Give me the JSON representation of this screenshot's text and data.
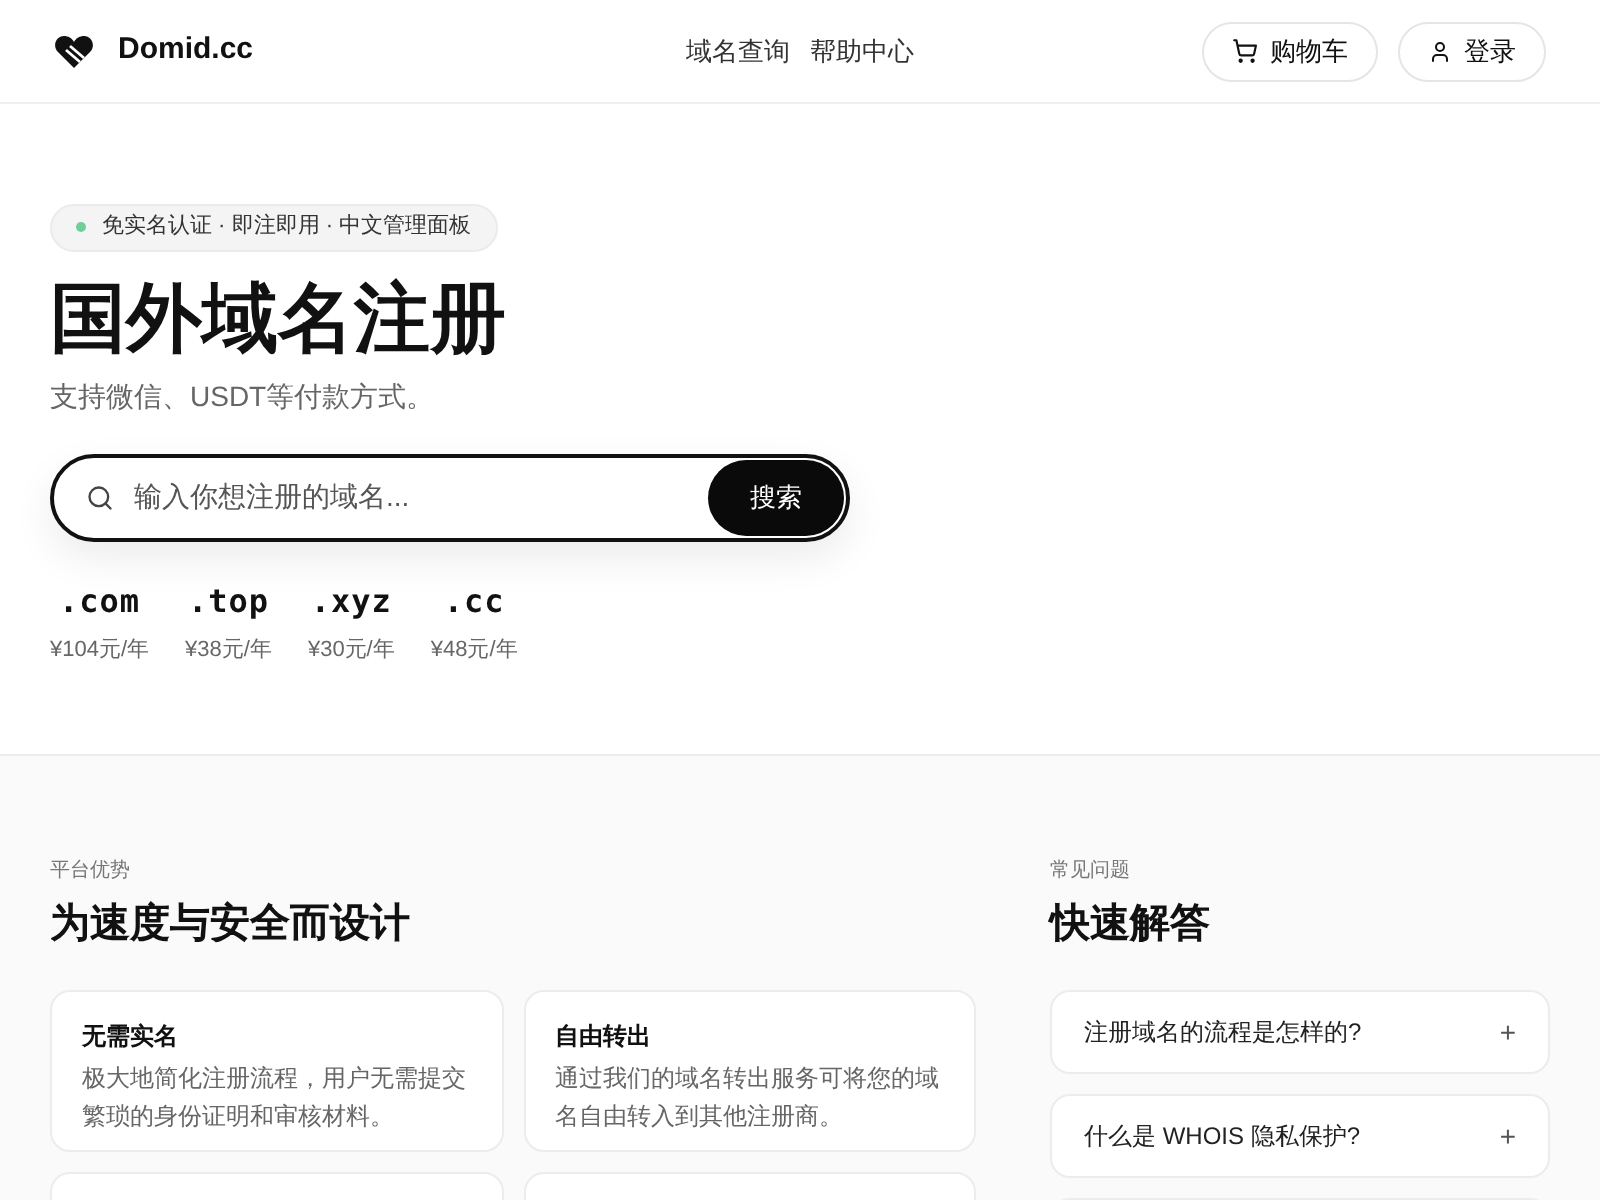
{
  "header": {
    "brand": "Domid.cc",
    "nav": [
      "域名查询",
      "帮助中心"
    ],
    "cart": "购物车",
    "login": "登录"
  },
  "hero": {
    "badge": "免实名认证 · 即注即用 · 中文管理面板",
    "title": "国外域名注册",
    "subtitle": "支持微信、USDT等付款方式。",
    "search": {
      "placeholder": "输入你想注册的域名...",
      "button": "搜索"
    },
    "tlds": [
      {
        "name": ".com",
        "price": "¥104元/年"
      },
      {
        "name": ".top",
        "price": "¥38元/年"
      },
      {
        "name": ".xyz",
        "price": "¥30元/年"
      },
      {
        "name": ".cc",
        "price": "¥48元/年"
      }
    ]
  },
  "features": {
    "eyebrow": "平台优势",
    "title": "为速度与安全而设计",
    "cards": [
      {
        "title": "无需实名",
        "text": "极大地简化注册流程，用户无需提交繁琐的身份证明和审核材料。"
      },
      {
        "title": "自由转出",
        "text": "通过我们的域名转出服务可将您的域名自由转入到其他注册商。"
      }
    ]
  },
  "faq": {
    "eyebrow": "常见问题",
    "title": "快速解答",
    "items": [
      {
        "question": "注册域名的流程是怎样的?",
        "toggle": "+"
      },
      {
        "question": "什么是 WHOIS 隐私保护?",
        "toggle": "+"
      }
    ]
  }
}
